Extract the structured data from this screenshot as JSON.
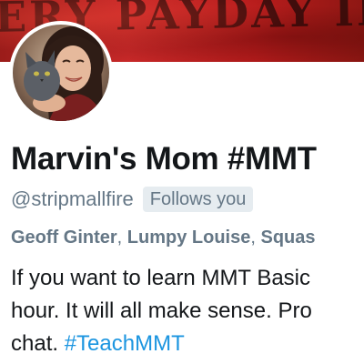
{
  "banner": {
    "text": "ERY PAYDAY IN",
    "colors": {
      "background": "#c62828",
      "text": "#2a0b0a"
    }
  },
  "profile": {
    "display_name": "Marvin's Mom #MMT",
    "handle": "@stripmallfire",
    "follows_badge": "Follows you",
    "followed_by": [
      "Geoff Ginter",
      "Lumpy Louise",
      "Squas"
    ],
    "followed_by_separator": ", ",
    "bio_lines": [
      "If you want to learn MMT Basic",
      "hour. It will all make sense. Pro",
      "chat. "
    ],
    "bio_hashtag": "#TeachMMT"
  },
  "colors": {
    "primary_text": "#14171a",
    "secondary_text": "#657786",
    "badge_background": "#e6ecf0",
    "link": "#1b95e0"
  }
}
